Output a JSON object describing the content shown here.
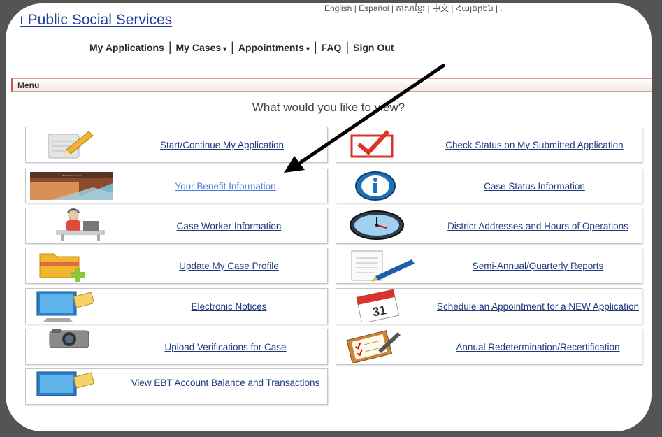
{
  "header": {
    "site_title": "ı Public Social Services",
    "languages": "English | Español | ភាសាខ្មែរ | 中文 | Հայերեն | ."
  },
  "nav": {
    "my_applications": "My Applications",
    "my_cases": "My Cases",
    "appointments": "Appointments",
    "faq": "FAQ",
    "sign_out": "Sign Out",
    "caret": "▾"
  },
  "menu": {
    "title": "Menu",
    "prompt": "What would you like to view?"
  },
  "tiles": {
    "start_app": "Start/Continue My Application",
    "check_status": "Check Status on My Submitted Application",
    "benefit_info": "Your Benefit Information",
    "case_status": "Case Status Information",
    "case_worker": "Case Worker Information",
    "district": "District Addresses and Hours of Operations",
    "update_profile": "Update My Case Profile",
    "reports": "Semi-Annual/Quarterly Reports",
    "notices": "Electronic Notices",
    "schedule": "Schedule an Appointment for a NEW Application",
    "upload": "Upload Verifications for Case",
    "annual": "Annual Redetermination/Recertification",
    "ebt": "View EBT Account Balance and Transactions"
  },
  "icons": {
    "calendar_day": "31"
  }
}
